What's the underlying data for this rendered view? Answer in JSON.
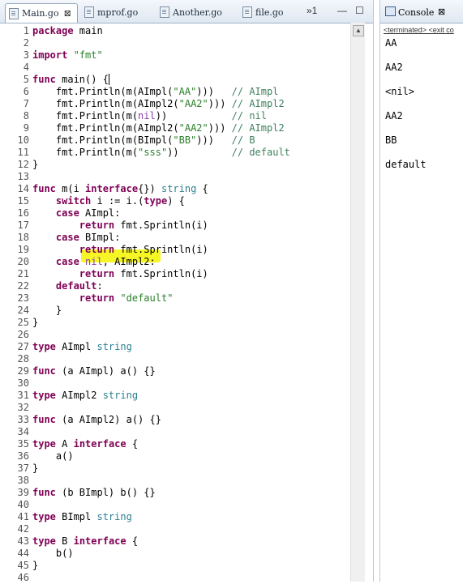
{
  "editor": {
    "tabs": [
      {
        "label": "Main.go",
        "close": "⊠"
      },
      {
        "label": "mprof.go"
      },
      {
        "label": "Another.go"
      },
      {
        "label": "file.go"
      }
    ],
    "overflow": "»1",
    "minimize": "—",
    "maximize": "☐",
    "lines": [
      [
        "1",
        "package main"
      ],
      [
        "2",
        ""
      ],
      [
        "3",
        "import \"fmt\""
      ],
      [
        "4",
        ""
      ],
      [
        "5",
        "func main() {"
      ],
      [
        "6",
        "    fmt.Println(m(AImpl(\"AA\")))   // AImpl"
      ],
      [
        "7",
        "    fmt.Println(m(AImpl2(\"AA2\"))) // AImpl2"
      ],
      [
        "8",
        "    fmt.Println(m(nil))           // nil"
      ],
      [
        "9",
        "    fmt.Println(m(AImpl2(\"AA2\"))) // AImpl2"
      ],
      [
        "10",
        "    fmt.Println(m(BImpl(\"BB\")))   // B"
      ],
      [
        "11",
        "    fmt.Println(m(\"sss\"))         // default"
      ],
      [
        "12",
        "}"
      ],
      [
        "13",
        ""
      ],
      [
        "14",
        "func m(i interface{}) string {"
      ],
      [
        "15",
        "    switch i := i.(type) {"
      ],
      [
        "16",
        "    case AImpl:"
      ],
      [
        "17",
        "        return fmt.Sprintln(i)"
      ],
      [
        "18",
        "    case BImpl:"
      ],
      [
        "19",
        "        return fmt.Sprintln(i)"
      ],
      [
        "20",
        "    case nil, AImpl2:"
      ],
      [
        "21",
        "        return fmt.Sprintln(i)"
      ],
      [
        "22",
        "    default:"
      ],
      [
        "23",
        "        return \"default\""
      ],
      [
        "24",
        "    }"
      ],
      [
        "25",
        "}"
      ],
      [
        "26",
        ""
      ],
      [
        "27",
        "type AImpl string"
      ],
      [
        "28",
        ""
      ],
      [
        "29",
        "func (a AImpl) a() {}"
      ],
      [
        "30",
        ""
      ],
      [
        "31",
        "type AImpl2 string"
      ],
      [
        "32",
        ""
      ],
      [
        "33",
        "func (a AImpl2) a() {}"
      ],
      [
        "34",
        ""
      ],
      [
        "35",
        "type A interface {"
      ],
      [
        "36",
        "    a()"
      ],
      [
        "37",
        "}"
      ],
      [
        "38",
        ""
      ],
      [
        "39",
        "func (b BImpl) b() {}"
      ],
      [
        "40",
        ""
      ],
      [
        "41",
        "type BImpl string"
      ],
      [
        "42",
        ""
      ],
      [
        "43",
        "type B interface {"
      ],
      [
        "44",
        "    b()"
      ],
      [
        "45",
        "}"
      ],
      [
        "46",
        ""
      ]
    ]
  },
  "console": {
    "title": "Console",
    "close": "⊠",
    "status": "<terminated> <exit co",
    "output": [
      "AA",
      "AA2",
      "<nil>",
      "AA2",
      "BB",
      "default"
    ]
  }
}
